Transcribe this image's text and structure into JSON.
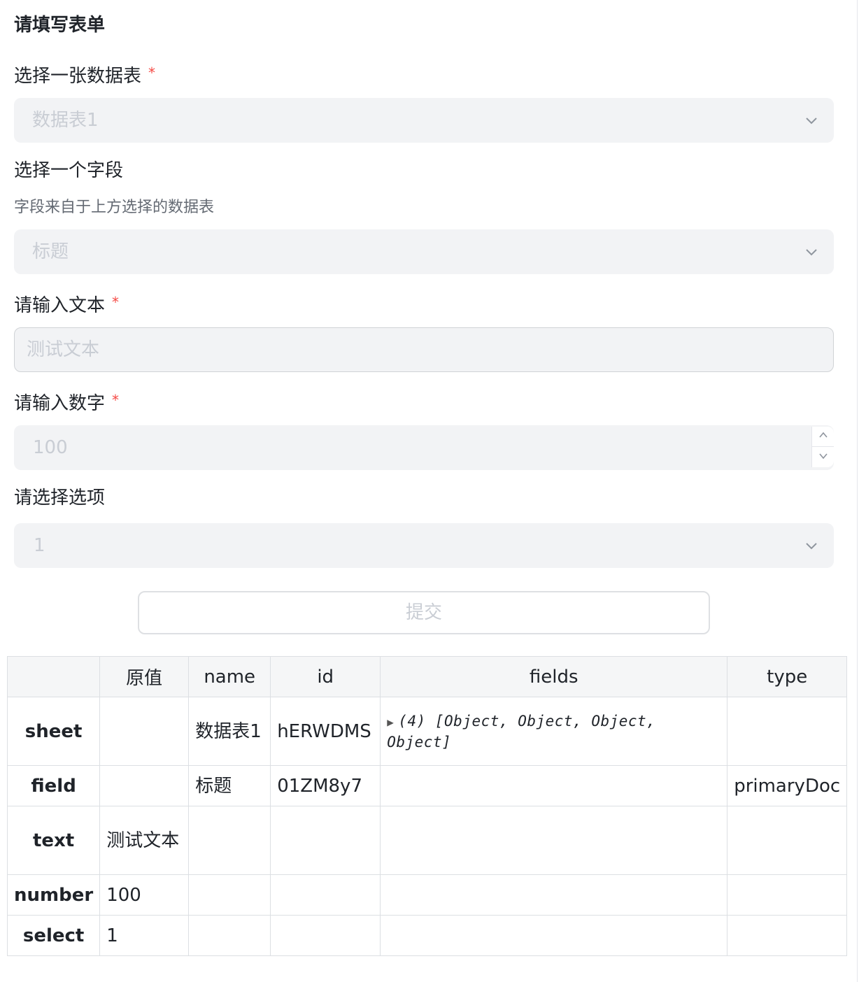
{
  "form": {
    "title": "请填写表单",
    "sheet_field": {
      "label": "选择一张数据表",
      "required_mark": "*",
      "value": "数据表1",
      "icon": "chevron-down-icon"
    },
    "field_field": {
      "label": "选择一个字段",
      "description": "字段来自于上方选择的数据表",
      "value": "标题",
      "icon": "chevron-down-icon"
    },
    "text_field": {
      "label": "请输入文本",
      "required_mark": "*",
      "value": "测试文本"
    },
    "number_field": {
      "label": "请输入数字",
      "required_mark": "*",
      "value": "100",
      "up_icon": "chevron-up-icon",
      "down_icon": "chevron-down-icon"
    },
    "select_field": {
      "label": "请选择选项",
      "value": "1",
      "icon": "chevron-down-icon"
    },
    "submit_label": "提交"
  },
  "table": {
    "headers": [
      "",
      "原值",
      "name",
      "id",
      "fields",
      "type"
    ],
    "rows": [
      {
        "key": "sheet",
        "raw": "",
        "name": "数据表1",
        "id": "hERWDMS",
        "fields_toggle": "▶",
        "fields": "(4) [Object, Object, Object, Object]",
        "type": ""
      },
      {
        "key": "field",
        "raw": "",
        "name": "标题",
        "id": "01ZM8y7",
        "fields_toggle": "",
        "fields": "",
        "type": "primaryDoc"
      },
      {
        "key": "text",
        "raw": "测试文本",
        "name": "",
        "id": "",
        "fields_toggle": "",
        "fields": "",
        "type": ""
      },
      {
        "key": "number",
        "raw": "100",
        "name": "",
        "id": "",
        "fields_toggle": "",
        "fields": "",
        "type": ""
      },
      {
        "key": "select",
        "raw": "1",
        "name": "",
        "id": "",
        "fields_toggle": "",
        "fields": "",
        "type": ""
      }
    ]
  },
  "colors": {
    "required": "#f54a45",
    "input_bg": "#f2f3f5",
    "placeholder": "#c9cdd4",
    "header_bg": "#f5f6f7"
  }
}
